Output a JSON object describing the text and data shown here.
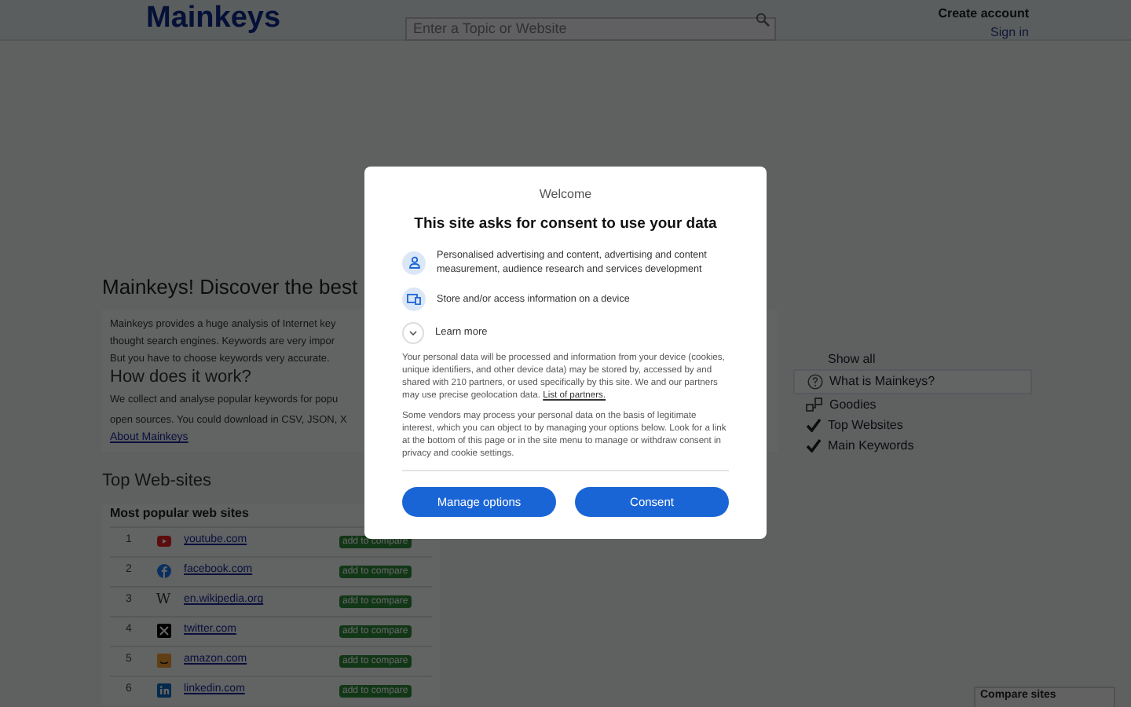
{
  "header": {
    "logo": "Mainkeys",
    "search": {
      "placeholder": "Enter a Topic or Website"
    },
    "create_account": "Create account",
    "sign_in": "Sign in"
  },
  "intro": {
    "title": "Mainkeys! Discover the best",
    "lines": [
      "Mainkeys provides a huge analysis of Internet key",
      "thought search engines. Keywords are very impor",
      "But you have to choose keywords very accurate."
    ],
    "subtitle": "How does it work?",
    "lines2": [
      "We collect and analyse popular keywords for popu",
      "open sources. You could download in CSV, JSON, X"
    ],
    "link": "About Mainkeys"
  },
  "sidebar": {
    "items": [
      {
        "label": "Show all",
        "kind": "plain",
        "selected": false
      },
      {
        "label": "What is Mainkeys?",
        "kind": "help",
        "selected": true
      },
      {
        "label": "Goodies",
        "kind": "goodies",
        "selected": false
      },
      {
        "label": "Top Websites",
        "kind": "check",
        "selected": false
      },
      {
        "label": "Main Keywords",
        "kind": "check",
        "selected": false
      }
    ]
  },
  "top_sites": {
    "title": "Top Web-sites",
    "table_title": "Most popular web sites",
    "rows": [
      {
        "rank": "1",
        "kind": "video",
        "site": "youtube.com",
        "action": "add to compare"
      },
      {
        "rank": "2",
        "kind": "f-circle",
        "site": "facebook.com",
        "action": "add to compare"
      },
      {
        "rank": "3",
        "kind": "letter",
        "logo_text": "W",
        "site": "en.wikipedia.org",
        "action": "add to compare"
      },
      {
        "rank": "4",
        "kind": "x-square",
        "site": "twitter.com",
        "action": "add to compare"
      },
      {
        "rank": "5",
        "kind": "orange-square",
        "site": "amazon.com",
        "action": "add to compare"
      },
      {
        "rank": "6",
        "kind": "in-square",
        "site": "linkedin.com",
        "action": "add to compare"
      }
    ]
  },
  "compare": {
    "title": "Compare sites"
  },
  "consent": {
    "welcome": "Welcome",
    "title": "This site asks for consent to use your data",
    "purposes": [
      {
        "kind": "person",
        "text": "Personalised advertising and content, advertising and content measurement, audience research and services development"
      },
      {
        "kind": "device",
        "text": "Store and/or access information on a device"
      }
    ],
    "learn_more": "Learn more",
    "expanded": false,
    "paragraph1": "Your personal data will be processed and information from your device (cookies, unique identifiers, and other device data) may be stored by, accessed by and shared with 210 partners, or used specifically by this site. We and our partners may use precise geolocation data.",
    "partners_link": "List of partners.",
    "paragraph2": "Some vendors may process your personal data on the basis of legitimate interest, which you can object to by managing your options below. Look for a link at the bottom of this page or in the site menu to manage or withdraw consent in privacy and cookie settings.",
    "buttons": [
      "Manage options",
      "Consent"
    ]
  }
}
